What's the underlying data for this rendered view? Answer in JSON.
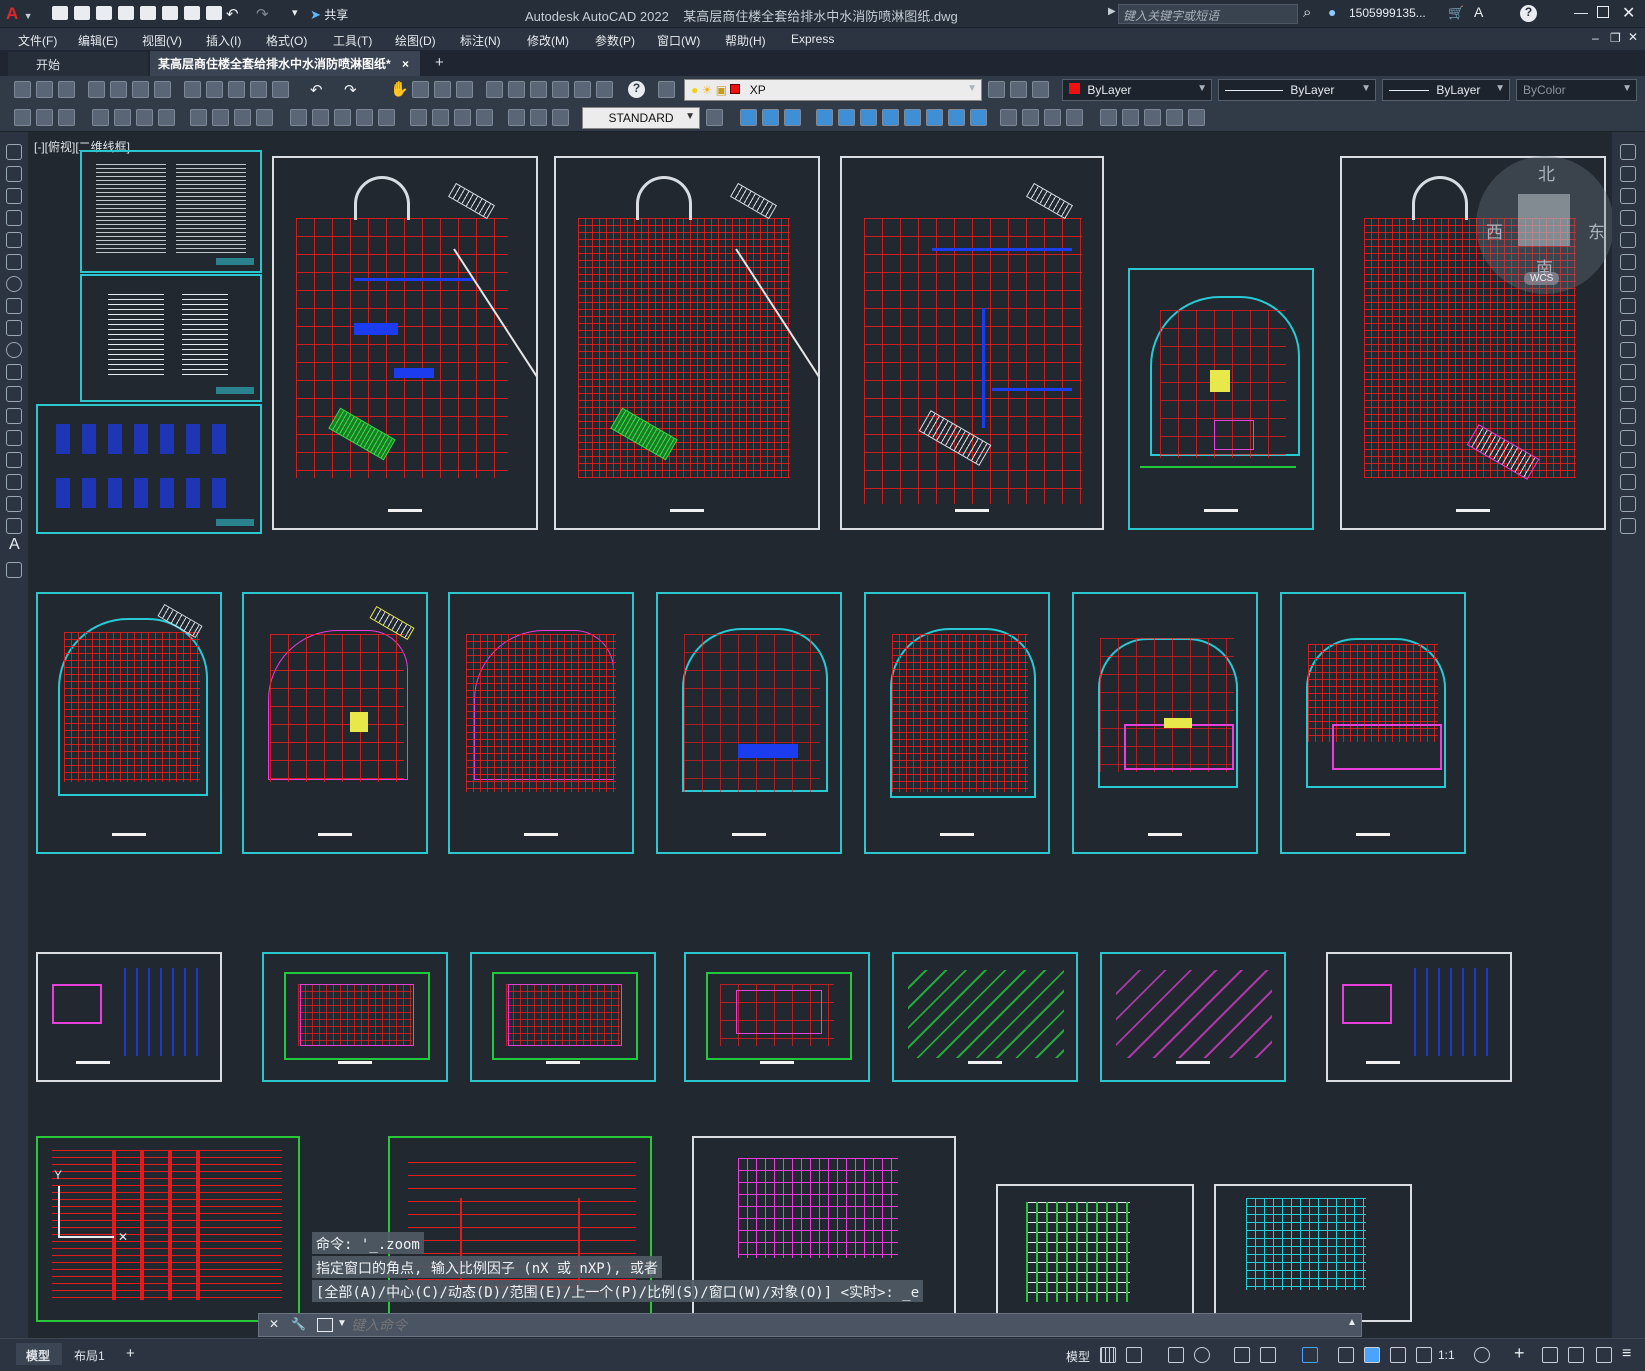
{
  "app": {
    "logo_letter": "A",
    "title": "Autodesk AutoCAD 2022",
    "document_title": "某高层商住楼全套给排水中水消防喷淋图纸.dwg",
    "search_placeholder": "键入关键字或短语",
    "user": "1505999135...",
    "share_label": "共享",
    "brand_color": "#d7262c",
    "accent_color": "#2bc7cf"
  },
  "menu": [
    "文件(F)",
    "编辑(E)",
    "视图(V)",
    "插入(I)",
    "格式(O)",
    "工具(T)",
    "绘图(D)",
    "标注(N)",
    "修改(M)",
    "参数(P)",
    "窗口(W)",
    "帮助(H)",
    "Express"
  ],
  "tabs": {
    "start": "开始",
    "active": "某高层商住楼全套给排水中水消防喷淋图纸*",
    "close": "×",
    "add": "+"
  },
  "layer": {
    "current": "XP",
    "color_label": "ByLayer",
    "linetype": "ByLayer",
    "lineweight": "ByLayer",
    "plotstyle": "ByColor",
    "textstyle": "STANDARD"
  },
  "viewport_label": "[-][俯视][二维线框]",
  "viewcube": {
    "north": "北",
    "south": "南",
    "east": "东",
    "west": "西",
    "wcs": "WCS"
  },
  "command": {
    "history": [
      "命令: '_.zoom",
      "指定窗口的角点, 输入比例因子 (nX 或 nXP), 或者",
      "[全部(A)/中心(C)/动态(D)/范围(E)/上一个(P)/比例(S)/窗口(W)/对象(O)] <实时>: _e"
    ],
    "placeholder": "键入命令"
  },
  "layout_tabs": [
    "模型",
    "布局1"
  ],
  "status": {
    "model": "模型",
    "scale": "1:1"
  }
}
